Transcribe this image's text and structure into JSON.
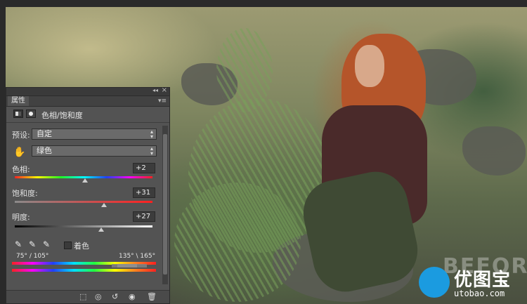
{
  "panel": {
    "tab_label": "属性",
    "title": "色相/饱和度",
    "preset_label": "预设:",
    "preset_value": "自定",
    "channel_value": "绿色",
    "hue": {
      "label": "色相:",
      "value": "+2",
      "level": 0.51
    },
    "saturation": {
      "label": "饱和度:",
      "value": "+31",
      "level": 0.65
    },
    "lightness": {
      "label": "明度:",
      "value": "+27",
      "level": 0.63
    },
    "colorize_label": "着色",
    "colorize_checked": false,
    "range_left": "75° / 105°",
    "range_right": "135° \\ 165°"
  },
  "overlay": {
    "before_text": "BEFORE",
    "logo_text": "优图宝",
    "logo_url": "utobao.com"
  },
  "colors": {
    "panel_bg": "#535353",
    "logo_blue": "#1b9be0"
  }
}
